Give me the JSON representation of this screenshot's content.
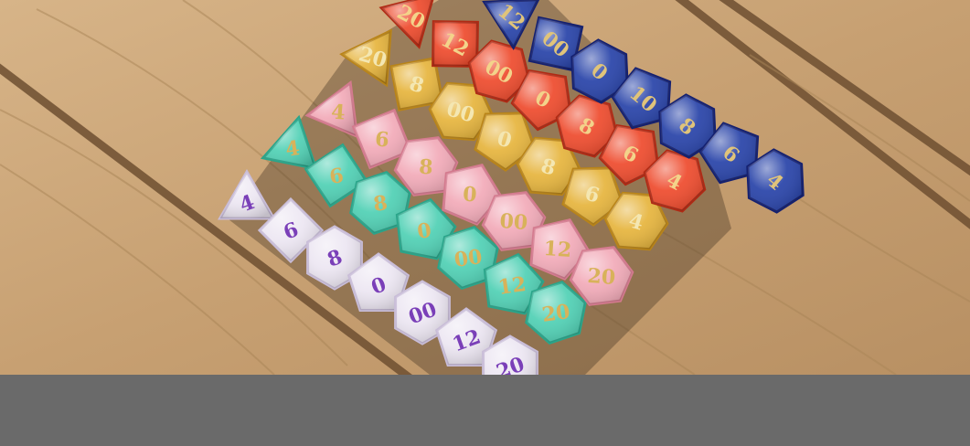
{
  "photo": {
    "subject": "dice-sets-on-wooden-deck",
    "colors": {
      "wood": "#c9a478",
      "wood_dark": "#8a6a48",
      "bar": "#6a6a6a"
    },
    "dice_rows": [
      {
        "set": "purple-white",
        "fill": "#ece6f2",
        "edge": "#c9bdd8",
        "digit_color": "#7a3fb8",
        "numbers": [
          "4",
          "6",
          "8",
          "0",
          "00",
          "12",
          "20"
        ]
      },
      {
        "set": "mint-green",
        "fill": "#4fd0b4",
        "edge": "#2aa58a",
        "digit_color": "#d8b25a",
        "numbers": [
          "4",
          "6",
          "8",
          "0",
          "00",
          "12",
          "20"
        ]
      },
      {
        "set": "pink-glitter",
        "fill": "#f2aab8",
        "edge": "#d47a8e",
        "digit_color": "#d8b25a",
        "numbers": [
          "4",
          "6",
          "8",
          "0",
          "00",
          "12",
          "20"
        ]
      },
      {
        "set": "gold-glitter",
        "fill": "#e6b43c",
        "edge": "#b98418",
        "digit_color": "#f4e7b2",
        "numbers": [
          "20",
          "8",
          "00",
          "0",
          "8",
          "6",
          "4"
        ]
      },
      {
        "set": "red-orange",
        "fill": "#ee4a2c",
        "edge": "#b02a14",
        "digit_color": "#f3d38a",
        "numbers": [
          "20",
          "12",
          "00",
          "0",
          "8",
          "6",
          "4"
        ]
      },
      {
        "set": "blue-sparkle",
        "fill": "#2742a8",
        "edge": "#142070",
        "digit_color": "#e0c47a",
        "numbers": [
          "12",
          "00",
          "0",
          "10",
          "8",
          "6",
          "4"
        ]
      }
    ]
  }
}
